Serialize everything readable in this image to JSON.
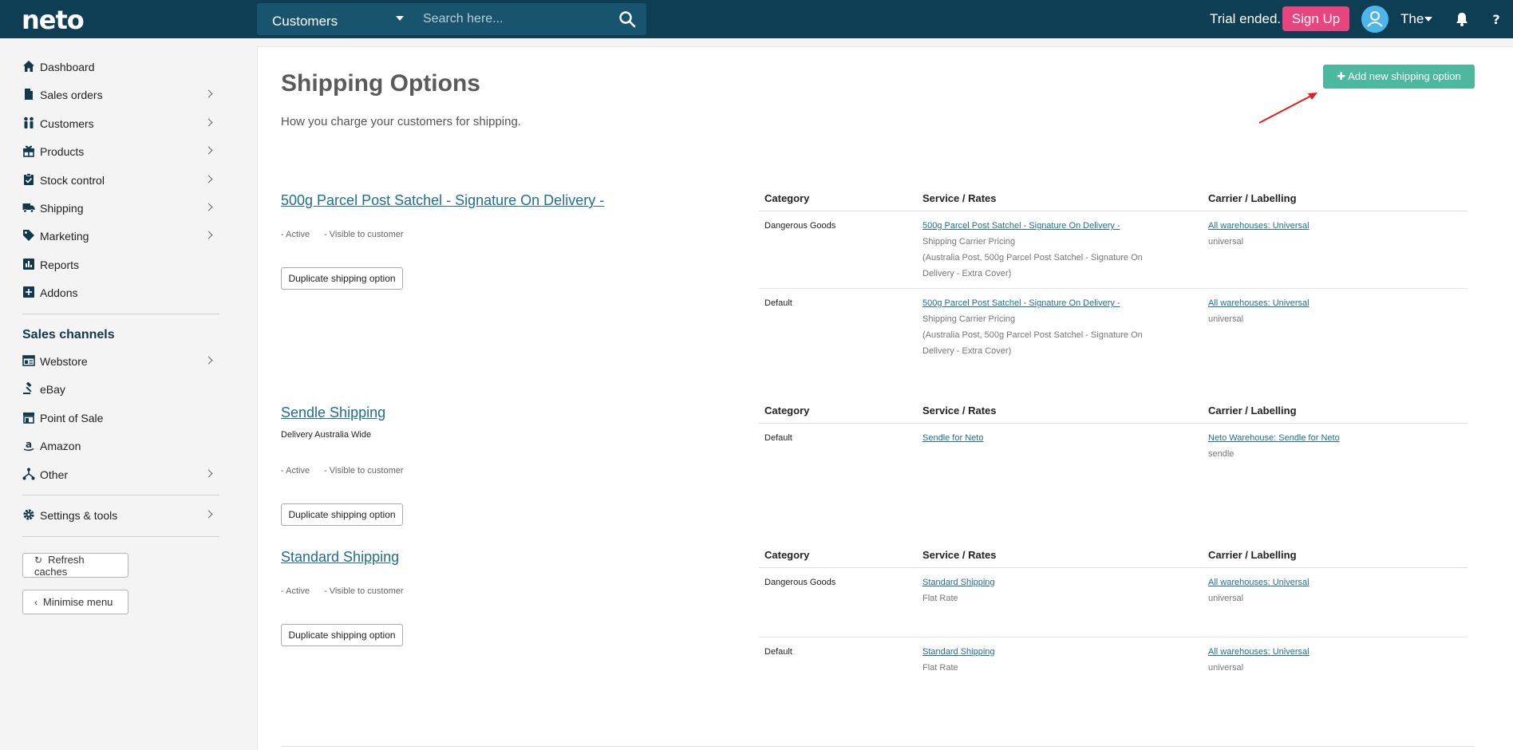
{
  "topbar": {
    "logo": "neto",
    "module": "Customers",
    "search_placeholder": "Search here...",
    "trial_text": "Trial ended.",
    "signup_label": "Sign Up",
    "user_name": "The"
  },
  "sidebar": {
    "items": [
      {
        "label": "Dashboard",
        "icon": "home-icon"
      },
      {
        "label": "Sales orders",
        "icon": "document-icon"
      },
      {
        "label": "Customers",
        "icon": "people-icon"
      },
      {
        "label": "Products",
        "icon": "gift-icon"
      },
      {
        "label": "Stock control",
        "icon": "clipboard-check-icon"
      },
      {
        "label": "Shipping",
        "icon": "truck-icon"
      },
      {
        "label": "Marketing",
        "icon": "tag-icon"
      },
      {
        "label": "Reports",
        "icon": "chart-icon"
      },
      {
        "label": "Addons",
        "icon": "plus-square-icon"
      }
    ],
    "sales_channels_title": "Sales channels",
    "channels": [
      {
        "label": "Webstore",
        "icon": "webstore-icon"
      },
      {
        "label": "eBay",
        "icon": "gavel-icon"
      },
      {
        "label": "Point of Sale",
        "icon": "store-icon"
      },
      {
        "label": "Amazon",
        "icon": "amazon-icon"
      },
      {
        "label": "Other",
        "icon": "sitemap-icon"
      }
    ],
    "settings_label": "Settings & tools",
    "refresh_label": "Refresh caches",
    "minimise_label": "Minimise menu"
  },
  "main": {
    "title": "Shipping Options",
    "subtitle": "How you charge your customers for shipping.",
    "add_button": "Add new shipping option",
    "col_headers": {
      "category": "Category",
      "service": "Service / Rates",
      "carrier": "Carrier / Labelling"
    },
    "status_active": "- Active",
    "status_visible": "- Visible to customer",
    "duplicate_label": "Duplicate shipping option",
    "options": [
      {
        "title": "500g Parcel Post Satchel - Signature On Delivery -",
        "description": "",
        "rows": [
          {
            "category": "Dangerous Goods",
            "service_link": "500g Parcel Post Satchel - Signature On Delivery -",
            "service_type": "Shipping Carrier Pricing",
            "service_detail": "(Australia Post, 500g Parcel Post Satchel - Signature On Delivery - Extra Cover)",
            "carrier_link": "All warehouses: Universal",
            "carrier_sub": "universal"
          },
          {
            "category": "Default",
            "service_link": "500g Parcel Post Satchel - Signature On Delivery -",
            "service_type": "Shipping Carrier Pricing",
            "service_detail": "(Australia Post, 500g Parcel Post Satchel - Signature On Delivery - Extra Cover)",
            "carrier_link": "All warehouses: Universal",
            "carrier_sub": "universal"
          }
        ]
      },
      {
        "title": "Sendle Shipping",
        "description": "Delivery Australia Wide",
        "rows": [
          {
            "category": "Default",
            "service_link": "Sendle for Neto",
            "carrier_link": "Neto Warehouse: Sendle for Neto",
            "carrier_sub": "sendle"
          }
        ]
      },
      {
        "title": "Standard Shipping",
        "description": "",
        "rows": [
          {
            "category": "Dangerous Goods",
            "service_link": "Standard Shipping",
            "service_type": "Flat Rate",
            "carrier_link": "All warehouses: Universal",
            "carrier_sub": "universal"
          },
          {
            "category": "Default",
            "service_link": "Standard Shipping",
            "service_type": "Flat Rate",
            "carrier_link": "All warehouses: Universal",
            "carrier_sub": "universal"
          }
        ]
      }
    ]
  },
  "colors": {
    "topbar": "#0d3e54",
    "accent_green": "#4cb99f",
    "signup_pink": "#e8457f",
    "link_blue": "#1f6f8f",
    "annotation_arrow": "#e0201b"
  }
}
